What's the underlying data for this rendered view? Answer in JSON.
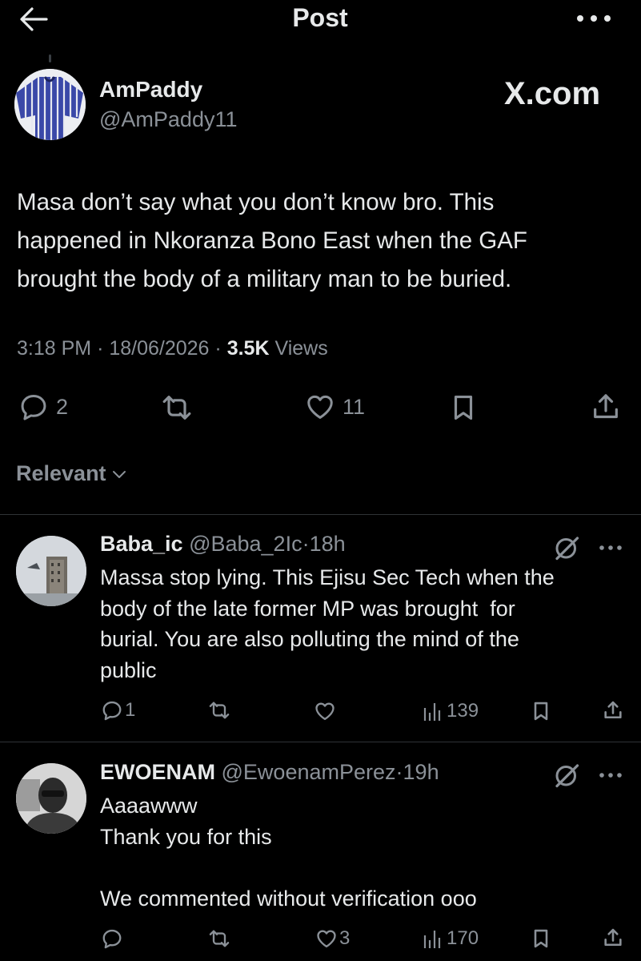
{
  "header": {
    "title": "Post"
  },
  "post": {
    "display_name": "AmPaddy",
    "handle": "@AmPaddy11",
    "watermark": "X.com",
    "text_lines": [
      "Masa don’t say what you don’t know bro. This",
      "happened in Nkoranza Bono East when the GAF",
      "brought the body of a military man to be buried."
    ],
    "time": "3:18 PM",
    "date": "18/06/2026",
    "views_count": "3.5K",
    "views_label": "Views",
    "sep": "·",
    "reply_count": "2",
    "like_count": "11"
  },
  "filter": {
    "label": "Relevant"
  },
  "replies": [
    {
      "display_name": "Baba_ic",
      "handle": "@Baba_2Ic",
      "time": "18h",
      "text_lines": [
        "Massa stop lying. This Ejisu Sec Tech when the",
        "body of the late former MP was brought  for",
        "burial. You are also polluting the mind of the",
        "public"
      ],
      "reply_count": "1",
      "like_count": "",
      "views_count": "139"
    },
    {
      "display_name": "EWOENAM",
      "handle": "@EwoenamPerez",
      "time": "19h",
      "text_lines": [
        "Aaaawww",
        "Thank you for this",
        "",
        "We commented without verification ooo"
      ],
      "reply_count": "",
      "like_count": "3",
      "views_count": "170"
    }
  ],
  "colors": {
    "background": "#000000",
    "text": "#e7e9ea",
    "secondary": "#8b9198",
    "divider": "#2f3336"
  }
}
